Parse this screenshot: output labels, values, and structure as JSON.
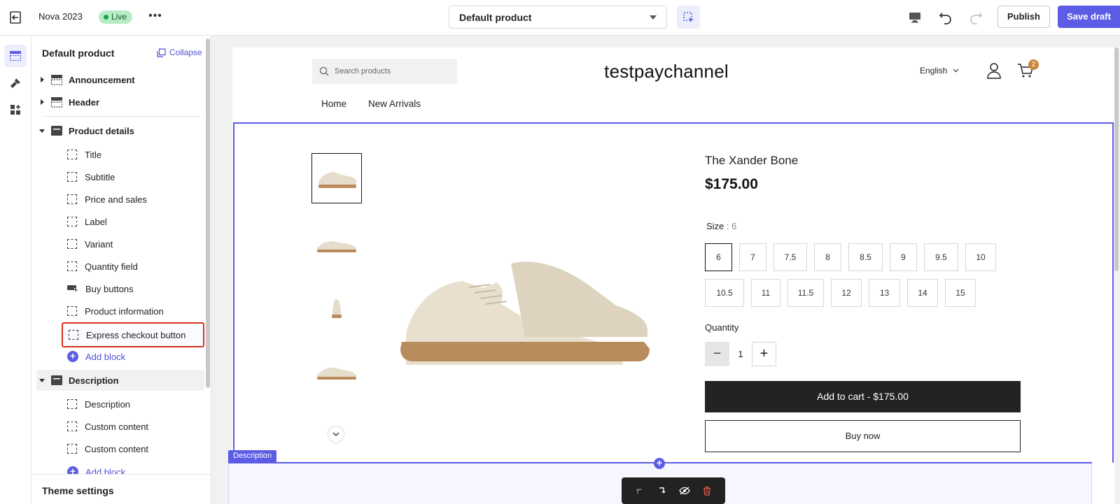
{
  "topbar": {
    "theme_name": "Nova 2023",
    "status_label": "Live",
    "more_label": "•••",
    "page_selector_value": "Default product",
    "publish_label": "Publish",
    "save_draft_label": "Save draft"
  },
  "sidebar": {
    "title": "Default product",
    "collapse_label": "Collapse",
    "sections": [
      {
        "label": "Announcement"
      },
      {
        "label": "Header"
      },
      {
        "label": "Product details"
      },
      {
        "label": "Description"
      }
    ],
    "product_blocks": [
      {
        "label": "Title"
      },
      {
        "label": "Subtitle"
      },
      {
        "label": "Price and sales"
      },
      {
        "label": "Label"
      },
      {
        "label": "Variant"
      },
      {
        "label": "Quantity field"
      },
      {
        "label": "Buy buttons"
      },
      {
        "label": "Product information"
      },
      {
        "label": "Express checkout button"
      }
    ],
    "description_blocks": [
      {
        "label": "Description"
      },
      {
        "label": "Custom content"
      },
      {
        "label": "Custom content"
      }
    ],
    "add_block_label": "Add block",
    "footer_label": "Theme settings"
  },
  "store": {
    "search_placeholder": "Search products",
    "brand": "testpaychannel",
    "language": "English",
    "cart_count": "2",
    "nav": [
      "Home",
      "New Arrivals"
    ]
  },
  "product": {
    "title": "The Xander Bone",
    "price": "$175.00",
    "size_label": "Size",
    "size_sep": " : ",
    "size_selected": "6",
    "sizes": [
      "6",
      "7",
      "7.5",
      "8",
      "8.5",
      "9",
      "9.5",
      "10",
      "10.5",
      "11",
      "11.5",
      "12",
      "13",
      "14",
      "15"
    ],
    "quantity_label": "Quantity",
    "quantity_value": "1",
    "add_to_cart_label": "Add to cart  -  $175.00",
    "buy_now_label": "Buy now"
  },
  "canvas": {
    "section_tag": "Description"
  },
  "colors": {
    "accent": "#5c5ce6",
    "selected_outline": "#d8321e",
    "live_bg": "#b8ecc6",
    "cart_badge": "#c8873b"
  }
}
